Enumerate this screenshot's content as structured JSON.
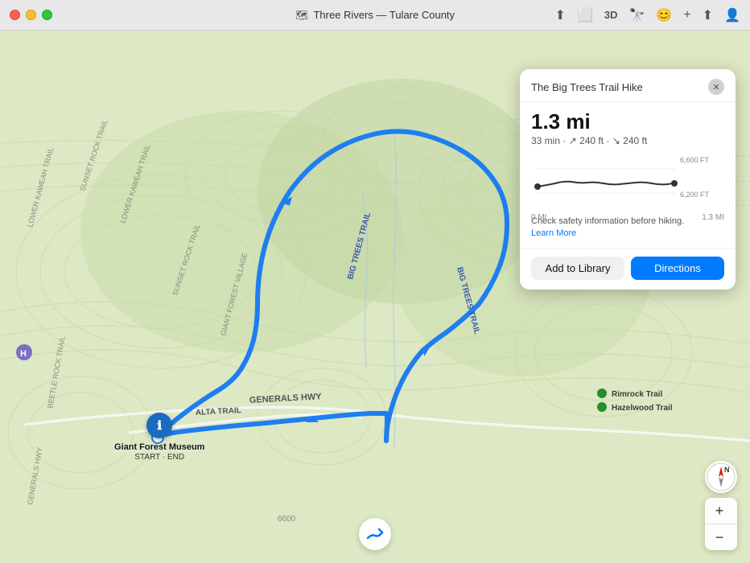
{
  "window": {
    "title": "Three Rivers — Tulare County",
    "title_icon": "🗺"
  },
  "toolbar": {
    "icons": [
      "✈",
      "⬜",
      "3D",
      "🔭",
      "😊",
      "+",
      "⬆",
      "👤"
    ]
  },
  "card": {
    "title": "The Big Trees Trail Hike",
    "distance": "1.3 mi",
    "details": "33 min · ↗ 240 ft · ↘ 240 ft",
    "elevation_high_label": "6,600 FT",
    "elevation_low_label": "6,200 FT",
    "dist_start": "0 MI",
    "dist_end": "1.3 MI",
    "safety_text": "Check safety information before hiking.",
    "learn_more_label": "Learn More",
    "add_library_label": "Add to Library",
    "directions_label": "Directions"
  },
  "map": {
    "trail_name_1": "BIG TREES TRAIL",
    "trail_name_2": "BIG TREES TRAIL",
    "highway_label": "GENERALS HWY",
    "alta_trail_label": "ALTA TRAIL",
    "museum_name": "Giant Forest Museum",
    "museum_sub": "START · END",
    "rimrock_trail": "Rimrock Trail",
    "hazelwood_trail": "Hazelwood Trail",
    "zoom_in": "+",
    "zoom_out": "−",
    "compass_label": "N"
  }
}
